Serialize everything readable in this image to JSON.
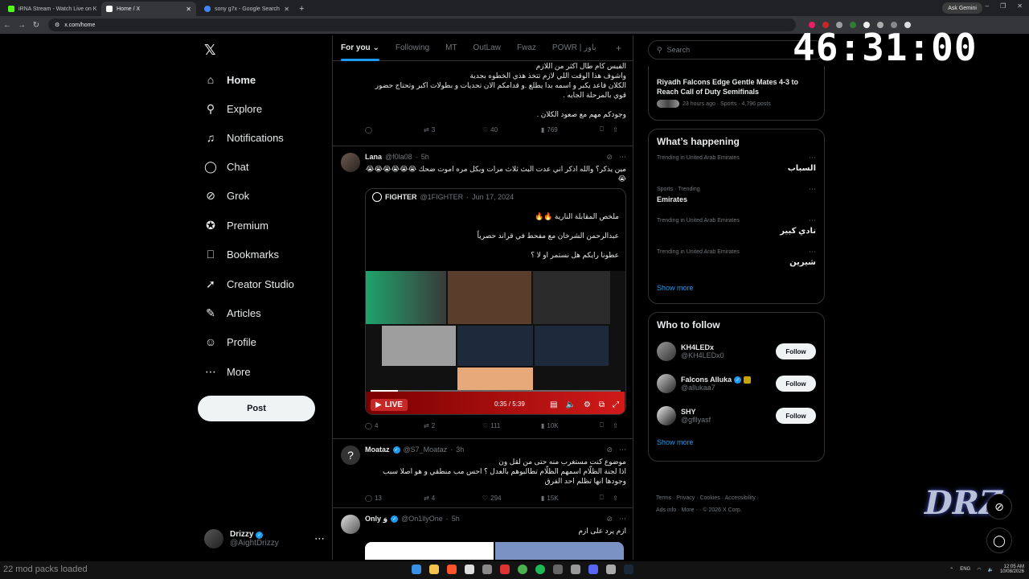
{
  "browser": {
    "tabs": [
      {
        "title": "iRNA Stream - Watch Live on K",
        "color": "#53fc18",
        "active": false
      },
      {
        "title": "Home / X",
        "color": "#ffffff",
        "active": true
      },
      {
        "title": "sony g7x - Google Search",
        "color": "#4285f4",
        "active": false
      }
    ],
    "url": "x.com/home",
    "gemini": "Ask Gemini"
  },
  "nav": {
    "items": [
      {
        "label": "Home",
        "icon": "home-icon",
        "glyph": "⌂"
      },
      {
        "label": "Explore",
        "icon": "search-icon",
        "glyph": "⚲"
      },
      {
        "label": "Notifications",
        "icon": "bell-icon",
        "glyph": "♫"
      },
      {
        "label": "Chat",
        "icon": "chat-icon",
        "glyph": "◯"
      },
      {
        "label": "Grok",
        "icon": "grok-icon",
        "glyph": "⊘"
      },
      {
        "label": "Premium",
        "icon": "premium-icon",
        "glyph": "✪"
      },
      {
        "label": "Bookmarks",
        "icon": "bookmark-icon",
        "glyph": "⎕"
      },
      {
        "label": "Creator Studio",
        "icon": "rocket-icon",
        "glyph": "➚"
      },
      {
        "label": "Articles",
        "icon": "articles-icon",
        "glyph": "✎"
      },
      {
        "label": "Profile",
        "icon": "person-icon",
        "glyph": "☺"
      },
      {
        "label": "More",
        "icon": "more-icon",
        "glyph": "⋯"
      }
    ],
    "post": "Post",
    "account": {
      "name": "Drizzy",
      "handle": "@AightDrizzy"
    }
  },
  "timeline": {
    "tabs": [
      "For you",
      "Following",
      "MT",
      "OutLaw",
      "Fwaz",
      "POWR | باور"
    ],
    "tweet1": {
      "lines": [
        "الفيس كام طال اكثر من اللازم",
        "واشوف هذا الوقت اللي لازم تتخذ هذي الخطوه بجدية",
        "الكلان قاعد يكبر و اسمه بدا يطلع .و قدامكم الان تحديات و بطولات اكبر وتحتاج حضور",
        "قوي بالمرحلة الجايه .",
        "وجودكم مهم مع صعود الكلان ."
      ],
      "retweets": "3",
      "likes": "40",
      "views": "769"
    },
    "tweet2": {
      "name": "Lana",
      "handle": "@f0la08",
      "time": "5h",
      "text": "مين يذكر؟ والله اذكر اني عدت البث ثلاث مرات وبكل مره اموت ضحك 😭😭😭😭😭😭😭",
      "quote": {
        "name": "FIGHTER",
        "handle": "@1FIGHTER",
        "date": "Jun 17, 2024",
        "lines": [
          "ملخص المقابلة النارية 🔥🔥",
          "عبدالرحمن الشرخان مع مفحط في قراند حصرياً",
          "عطونا رايكم هل نستمر او لا ؟"
        ]
      },
      "video": {
        "live": "LIVE",
        "time": "0:35 / 5:39",
        "progress": 0.11
      },
      "replies": "4",
      "retweets": "2",
      "likes": "111",
      "views": "10K"
    },
    "tweet3": {
      "name": "Moataz",
      "handle": "@S7_Moataz",
      "time": "3h",
      "lines": [
        "موضوع كنت مستغرب منه حتى من لقل ون",
        "اذا لجنة الظلّام اسمهم الظلّام تطالبوهم بالعدل ؟ احس مب منطقي و هو اصلا سبب",
        "وجودها انها تظلم احد الفرق"
      ],
      "replies": "13",
      "retweets": "4",
      "likes": "294",
      "views": "15K"
    },
    "tweet4": {
      "name": "Only وَ",
      "handle": "@On1llyOne",
      "time": "5h",
      "text": "ازم يرد على ازم"
    }
  },
  "sidebar": {
    "search_placeholder": "Search",
    "top_news": {
      "title": "Riyadh Falcons Edge Gentle Mates 4-3 to Reach Call of Duty Semifinals",
      "meta": "23 hours ago · Sports · 4,796 posts"
    },
    "happening_title": "What’s happening",
    "trends": [
      {
        "context": "Trending in United Arab Emirates",
        "name": "السباب",
        "rtl": true
      },
      {
        "context": "Sports · Trending",
        "name": "Emirates",
        "rtl": false
      },
      {
        "context": "Trending in United Arab Emirates",
        "name": "نادي كبير",
        "rtl": true
      },
      {
        "context": "Trending in United Arab Emirates",
        "name": "شيرين",
        "rtl": true
      }
    ],
    "show_more": "Show more",
    "who_to_follow_title": "Who to follow",
    "follow": [
      {
        "name": "KH4LEDx",
        "handle": "@KH4LEDx0",
        "verified": false,
        "button": "Follow"
      },
      {
        "name": "Falcons Alluka",
        "handle": "@allukaa7",
        "verified": true,
        "button": "Follow"
      },
      {
        "name": "SHY",
        "handle": "@gfllyasf",
        "verified": false,
        "button": "Follow"
      }
    ],
    "show_more_2": "Show more",
    "footer": [
      "Terms",
      "Privacy",
      "Cookies",
      "Accessibility",
      "Ads info",
      "More ···",
      "© 2026 X Corp."
    ]
  },
  "overlay": {
    "timer": "46:31:00",
    "brand": "DRZ",
    "mod_packs": "22 mod packs loaded"
  },
  "taskbar": {
    "lang": "ENG",
    "time": "12:05 AM",
    "date": "10/08/2026"
  }
}
